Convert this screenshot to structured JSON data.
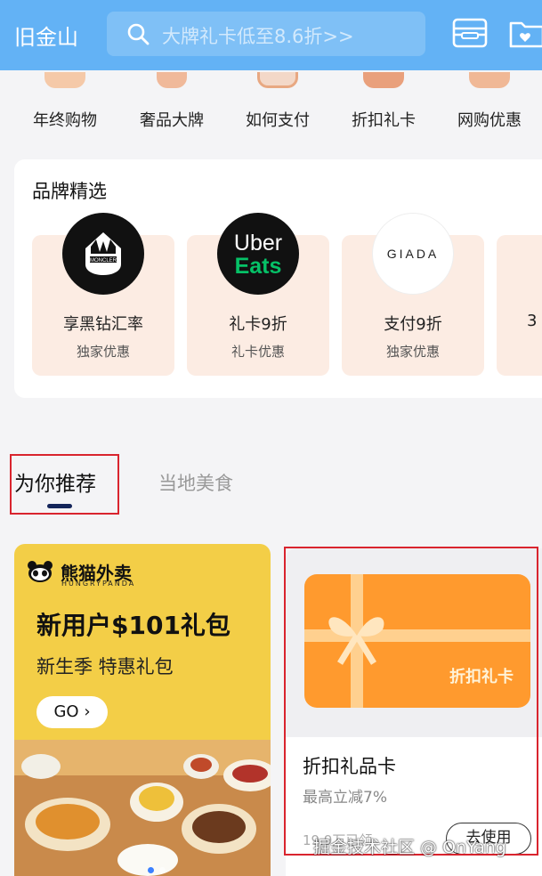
{
  "header": {
    "city": "旧金山",
    "search_placeholder": "大牌礼卡低至8.6折>>",
    "icons": [
      "wallet-icon",
      "folder-heart-icon"
    ]
  },
  "categories": [
    {
      "label": "年终购物"
    },
    {
      "label": "奢品大牌"
    },
    {
      "label": "如何支付"
    },
    {
      "label": "折扣礼卡"
    },
    {
      "label": "网购优惠"
    }
  ],
  "brand_section": {
    "title": "品牌精选",
    "items": [
      {
        "logo_text": "MONCLER",
        "name": "享黑钻汇率",
        "sub": "独家优惠"
      },
      {
        "logo_text_1": "Uber",
        "logo_text_2": "Eats",
        "name": "礼卡9折",
        "sub": "礼卡优惠"
      },
      {
        "logo_text": "GIADA",
        "name": "支付9折",
        "sub": "独家优惠"
      },
      {
        "name": "3"
      }
    ]
  },
  "tabs": [
    {
      "label": "为你推荐",
      "active": true
    },
    {
      "label": "当地美食",
      "active": false
    }
  ],
  "promo_card": {
    "brand_cn": "熊猫外卖",
    "brand_en": "HUNGRYPANDA",
    "title": "新用户$101礼包",
    "subtitle": "新生季 特惠礼包",
    "button": "GO",
    "button_icon": "chevron-right-icon"
  },
  "gift_card": {
    "card_label": "折扣礼卡",
    "title": "折扣礼品卡",
    "discount": "最高立减7%",
    "expiry": "19.9万已领",
    "button": "去使用"
  },
  "watermark": "掘金技术社区 @ OnYang",
  "colors": {
    "header_bg": "#63b2f5",
    "highlight_border": "#d9242e",
    "promo_bg": "#f3ce47",
    "gift_orange": "#ff9a2e",
    "tab_underline": "#14255a",
    "uber_green": "#06c167"
  }
}
